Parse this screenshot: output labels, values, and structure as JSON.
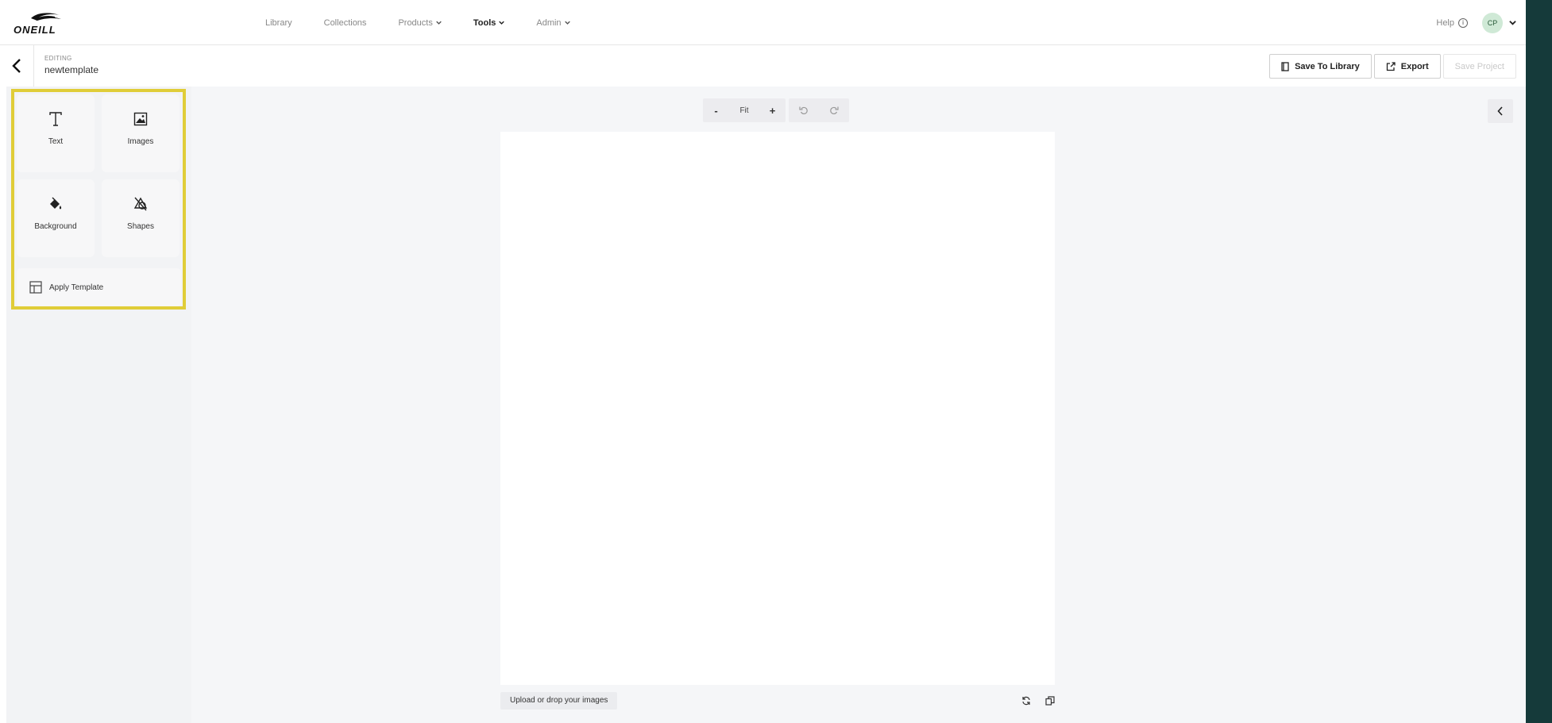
{
  "brand": {
    "logo_text": "ONEILL"
  },
  "nav": {
    "items": [
      {
        "label": "Library",
        "dropdown": false,
        "active": false
      },
      {
        "label": "Collections",
        "dropdown": false,
        "active": false
      },
      {
        "label": "Products",
        "dropdown": true,
        "active": false
      },
      {
        "label": "Tools",
        "dropdown": true,
        "active": true
      },
      {
        "label": "Admin",
        "dropdown": true,
        "active": false
      }
    ],
    "help_label": "Help",
    "user_initials": "CP"
  },
  "editor": {
    "mode_label": "EDITING",
    "project_name": "newtemplate",
    "save_to_library_label": "Save To Library",
    "export_label": "Export",
    "save_project_label": "Save Project"
  },
  "tools": {
    "text_label": "Text",
    "images_label": "Images",
    "background_label": "Background",
    "shapes_label": "Shapes",
    "apply_template_label": "Apply Template"
  },
  "canvas": {
    "zoom_out_label": "-",
    "zoom_fit_label": "Fit",
    "zoom_in_label": "+",
    "upload_label": "Upload or drop your images"
  },
  "colors": {
    "highlight": "#e0cd38",
    "avatar_bg": "#cfe9d6",
    "side_strip": "#153a3a"
  }
}
